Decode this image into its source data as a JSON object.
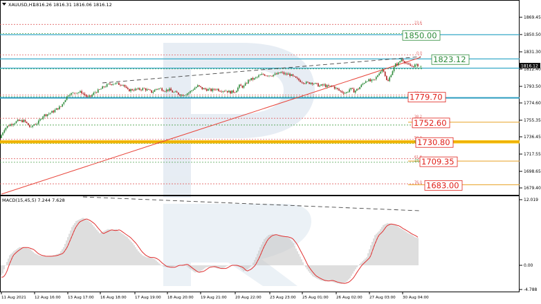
{
  "header": {
    "symbol": "XAUUSD,H1",
    "ohlc": "1816.26 1816.31 1816.06 1816.12"
  },
  "colors": {
    "bull": "#2e8b3a",
    "bear": "#b11f1f",
    "trend_red": "#e8443a",
    "level_cyan": "#35a9c8",
    "fib_red": "#e06060",
    "fib_green": "#4aa04a",
    "fib_orange": "#e8a020",
    "label_green": "#2e8b3a",
    "label_red": "#e0201a",
    "macd_hist": "#c9c9c9",
    "macd_signal": "#e03030",
    "dash": "#444444",
    "watermark": "#d9e3ee"
  },
  "main": {
    "current_price_label": "1816.12",
    "price_ticks": [
      "1869.45",
      "1850.50",
      "1831.30",
      "1812.40",
      "1793.50",
      "1774.60",
      "1755.35",
      "1736.45",
      "1717.55",
      "1698.65",
      "1679.40"
    ],
    "level_labels": [
      {
        "text": "1850.00",
        "kind": "green"
      },
      {
        "text": "1823.12",
        "kind": "green"
      },
      {
        "text": "1779.70",
        "kind": "red"
      },
      {
        "text": "1752.60",
        "kind": "red"
      },
      {
        "text": "1730.80",
        "kind": "red"
      },
      {
        "text": "1709.35",
        "kind": "red"
      },
      {
        "text": "1683.00",
        "kind": "red"
      }
    ],
    "fib_labels": [
      {
        "text": "23.6",
        "kind": "red"
      },
      {
        "text": "76.0",
        "kind": "green"
      },
      {
        "text": "0.0",
        "kind": "red"
      },
      {
        "text": "61.8",
        "kind": "green"
      },
      {
        "text": "23.6",
        "kind": "red"
      },
      {
        "text": "0.0",
        "kind": "green"
      },
      {
        "text": "38.2",
        "kind": "red"
      },
      {
        "text": "38.2",
        "kind": "green"
      },
      {
        "text": "50.0",
        "kind": "red"
      },
      {
        "text": "50.0",
        "kind": "green"
      },
      {
        "text": "61.8",
        "kind": "red"
      },
      {
        "text": "23.6",
        "kind": "green"
      },
      {
        "text": "76.0",
        "kind": "red"
      }
    ]
  },
  "macd": {
    "label": "MACD(15,45,5) 7.244 7.628",
    "ticks": [
      "12.019",
      "0.00",
      "-4.788"
    ]
  },
  "time_axis": {
    "labels": [
      "11 Aug 2021",
      "12 Aug 16:00",
      "13 Aug 17:00",
      "16 Aug 18:00",
      "17 Aug 19:00",
      "18 Aug 20:00",
      "19 Aug 21:00",
      "20 Aug 22:00",
      "23 Aug 23:00",
      "25 Aug 01:00",
      "26 Aug 02:00",
      "27 Aug 03:00",
      "30 Aug 04:00"
    ]
  },
  "chart_data": {
    "type": "candlestick",
    "symbol": "XAUUSD",
    "timeframe": "H1",
    "y_range": [
      1670,
      1880
    ],
    "close_path": {
      "x": [
        0,
        6,
        12,
        20,
        26,
        35,
        45,
        48,
        55,
        62,
        70,
        78,
        83,
        88,
        94,
        100,
        104,
        108,
        113,
        118,
        124,
        127,
        132,
        137,
        143,
        150,
        158,
        164,
        172,
        178,
        184,
        192,
        200,
        208,
        214,
        220,
        226,
        232,
        238,
        244,
        250,
        256,
        262,
        268,
        274,
        280,
        286,
        292,
        300,
        306,
        312,
        318,
        326,
        332,
        340,
        346,
        352,
        360,
        368,
        374,
        380,
        386,
        392,
        400,
        406,
        412,
        418,
        424,
        430,
        436,
        444,
        450,
        456,
        462,
        468,
        474,
        480,
        486,
        492,
        500,
        506,
        512,
        518,
        524,
        530,
        536,
        542,
        548,
        554,
        560,
        566,
        572,
        576,
        580,
        584,
        588,
        594,
        600,
        604
      ],
      "price": [
        1735,
        1745,
        1749,
        1752,
        1754,
        1754,
        1746,
        1750,
        1752,
        1760,
        1762,
        1765,
        1768,
        1770,
        1778,
        1785,
        1784,
        1786,
        1786,
        1786,
        1782,
        1780,
        1782,
        1786,
        1788,
        1792,
        1795,
        1796,
        1795,
        1795,
        1788,
        1789,
        1789,
        1790,
        1788,
        1786,
        1790,
        1790,
        1788,
        1789,
        1786,
        1785,
        1783,
        1784,
        1786,
        1790,
        1793,
        1790,
        1789,
        1788,
        1790,
        1788,
        1788,
        1786,
        1787,
        1793,
        1792,
        1800,
        1801,
        1804,
        1806,
        1805,
        1805,
        1806,
        1808,
        1806,
        1806,
        1803,
        1800,
        1798,
        1796,
        1797,
        1795,
        1793,
        1794,
        1792,
        1793,
        1790,
        1787,
        1785,
        1790,
        1787,
        1790,
        1795,
        1800,
        1798,
        1800,
        1808,
        1812,
        1796,
        1808,
        1817,
        1818,
        1823,
        1821,
        1817,
        1815,
        1816,
        1816
      ]
    },
    "levels": [
      1850.0,
      1823.12,
      1779.7,
      1752.6,
      1730.8,
      1709.35,
      1683.0
    ],
    "fib_retracement": {
      "high": 1827.5,
      "low": 1689.0,
      "ratios": [
        0.0,
        0.236,
        0.382,
        0.5,
        0.618,
        0.76
      ]
    },
    "fib_extension": [
      {
        "ratio": 0.236,
        "price": 1861.5
      },
      {
        "ratio": 0.76,
        "price": 1851.3
      }
    ],
    "macd": {
      "params": "15,45,5",
      "main": 7.244,
      "signal": 7.628,
      "y_range": [
        -4.788,
        12.019
      ],
      "histogram": {
        "x": [
          0,
          4,
          8,
          14,
          20,
          28,
          36,
          44,
          50,
          56,
          62,
          70,
          78,
          86,
          92,
          98,
          104,
          110,
          116,
          120,
          126,
          132,
          138,
          144,
          150,
          156,
          162,
          168,
          176,
          184,
          192,
          200,
          206,
          212,
          218,
          224,
          230,
          236,
          242,
          248,
          254,
          260,
          266,
          274,
          282,
          290,
          298,
          306,
          314,
          322,
          330,
          338,
          346,
          352,
          358,
          364,
          370,
          376,
          382,
          388,
          394,
          400,
          406,
          412,
          418,
          424,
          430,
          436,
          440,
          446,
          452,
          458,
          464,
          470,
          476,
          482,
          488,
          494,
          500,
          506,
          512,
          518,
          524,
          530,
          536,
          542,
          548,
          554,
          560,
          566,
          572,
          578,
          584,
          590,
          596,
          600,
          604
        ],
        "value": [
          -3,
          -2,
          0,
          2.5,
          3.5,
          4.5,
          4.5,
          4.0,
          3.0,
          2.5,
          2.3,
          2.3,
          2.5,
          3.0,
          4.5,
          7.0,
          9.5,
          11.0,
          11.5,
          11.8,
          11.3,
          10.5,
          9.2,
          8.0,
          8.5,
          9.0,
          8.8,
          9.0,
          8.0,
          7.0,
          5.5,
          3.5,
          2.5,
          2.0,
          2.0,
          1.5,
          0.5,
          -0.3,
          -0.5,
          -0.5,
          0,
          0,
          0.3,
          -0.8,
          -1.8,
          -1.5,
          -0.5,
          -0.3,
          -0.8,
          -0.8,
          0,
          0,
          -0.5,
          -1.5,
          -1.0,
          0,
          2,
          4.5,
          6.5,
          7.5,
          7.8,
          7.5,
          7.3,
          7.2,
          6.8,
          5.5,
          3.5,
          1.5,
          0,
          -1.5,
          -2.7,
          -3.3,
          -3.8,
          -4.0,
          -3.8,
          -4.2,
          -4.5,
          -4.6,
          -4.2,
          -3.2,
          -1.5,
          0,
          1,
          2,
          5,
          7.5,
          8.5,
          10,
          10.5,
          10.3,
          10,
          9.3,
          8.7,
          8.0,
          7.5,
          7.0,
          6.8
        ]
      }
    }
  }
}
